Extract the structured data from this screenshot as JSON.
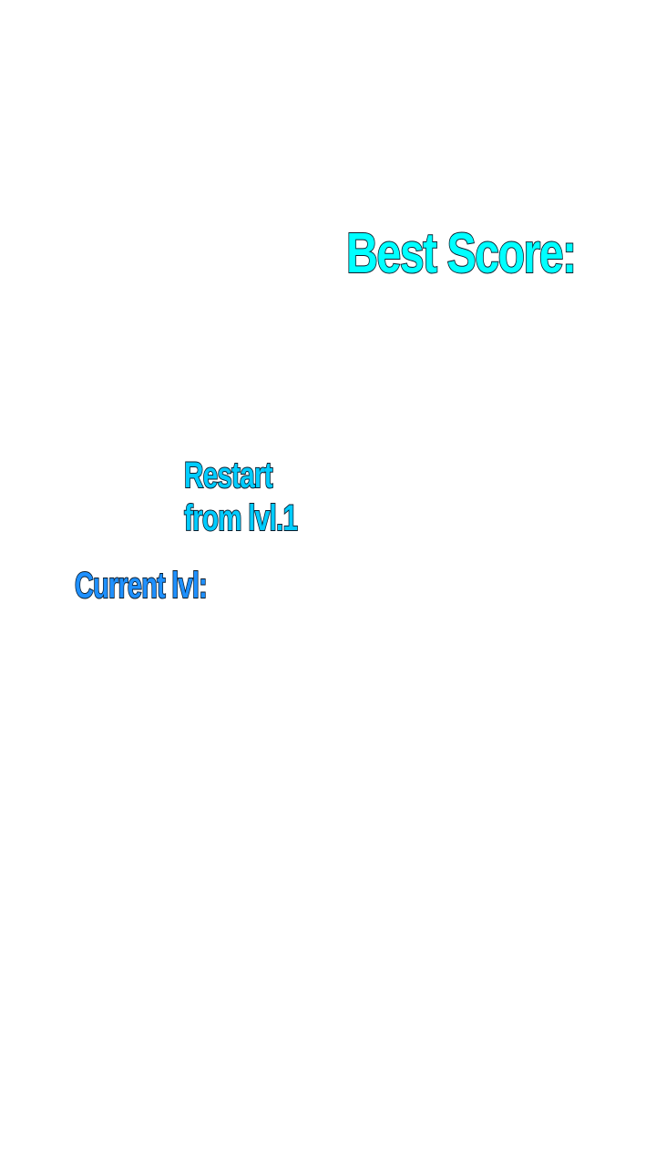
{
  "best_score": {
    "label": "Best Score:"
  },
  "restart": {
    "line1": "Restart",
    "line2": "from lvl.1"
  },
  "current_level": {
    "label": "Current lvl:"
  },
  "colors": {
    "background": "#ffffff",
    "best_score_text": "#00ffff",
    "restart_text": "#00ccff",
    "current_level_text": "#1e90ff",
    "outline": "#0a1a2a"
  }
}
